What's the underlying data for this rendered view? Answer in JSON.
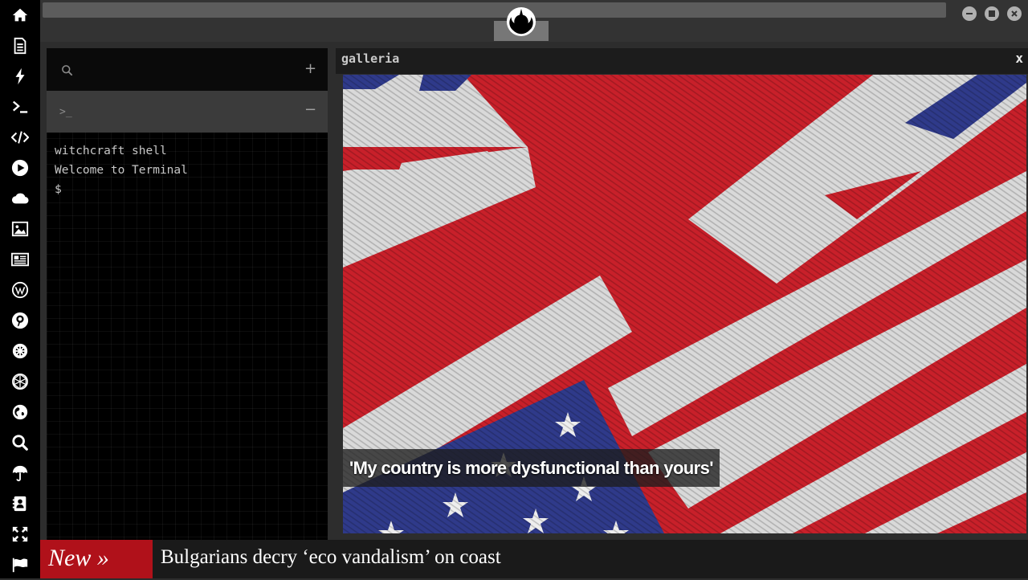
{
  "dock": {
    "items": [
      {
        "icon": "home-icon"
      },
      {
        "icon": "document-icon"
      },
      {
        "icon": "lightning-icon"
      },
      {
        "icon": "terminal-icon"
      },
      {
        "icon": "code-icon"
      },
      {
        "icon": "play-icon"
      },
      {
        "icon": "cloud-icon"
      },
      {
        "icon": "image-icon"
      },
      {
        "icon": "newspaper-icon"
      },
      {
        "icon": "wordpress-icon"
      },
      {
        "icon": "pinterest-icon"
      },
      {
        "icon": "helm-icon"
      },
      {
        "icon": "network-sphere-icon"
      },
      {
        "icon": "globe-icon"
      },
      {
        "icon": "search-icon"
      },
      {
        "icon": "umbrella-icon"
      },
      {
        "icon": "contacts-icon"
      },
      {
        "icon": "expand-icon"
      },
      {
        "icon": "flag-icon"
      }
    ]
  },
  "topbar": {
    "logo": "rebel-alliance-icon",
    "window_controls": [
      "minimize-icon",
      "maximize-icon",
      "close-icon"
    ]
  },
  "terminal": {
    "search_icon": "search-icon",
    "add_label": "+",
    "tab_prompt": ">_",
    "remove_label": "−",
    "lines": [
      "witchcraft shell",
      "Welcome to Terminal",
      "$"
    ]
  },
  "galleria": {
    "title": "galleria",
    "close_label": "x",
    "caption": "'My country is more dysfunctional than yours'"
  },
  "ticker": {
    "label": "New »",
    "headline": "Bulgarians decry ‘eco vandalism’ on coast"
  },
  "colors": {
    "dock_bg": "#000000",
    "ticker_label_bg": "#b0111a",
    "flag_red": "#c8202a",
    "flag_blue": "#2f3a8a"
  }
}
